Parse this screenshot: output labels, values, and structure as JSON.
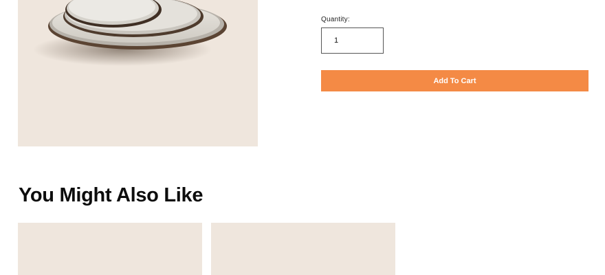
{
  "product": {
    "image_alt": "stacked ceramic plates"
  },
  "quantity": {
    "label": "Quantity:",
    "value": "1"
  },
  "cart": {
    "add_label": "Add To Cart"
  },
  "recommendations": {
    "title": "You Might Also Like"
  },
  "colors": {
    "image_bg": "#efe6dd",
    "accent": "#f48a45"
  }
}
